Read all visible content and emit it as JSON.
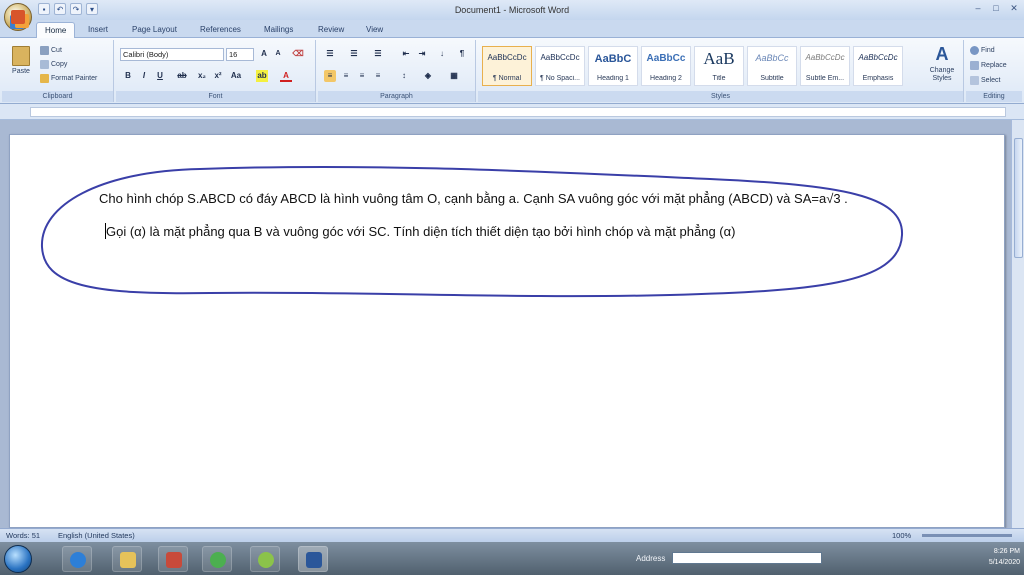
{
  "window": {
    "title": "Document1 - Microsoft Word"
  },
  "tabs": [
    {
      "label": "Home",
      "active": true
    },
    {
      "label": "Insert"
    },
    {
      "label": "Page Layout"
    },
    {
      "label": "References"
    },
    {
      "label": "Mailings"
    },
    {
      "label": "Review"
    },
    {
      "label": "View"
    }
  ],
  "clipboard": {
    "paste": "Paste",
    "cut": "Cut",
    "copy": "Copy",
    "format_painter": "Format Painter",
    "group": "Clipboard"
  },
  "font": {
    "name": "Calibri (Body)",
    "size": "16",
    "group": "Font"
  },
  "paragraph": {
    "group": "Paragraph"
  },
  "styles": {
    "items": [
      {
        "preview": "AaBbCcDc",
        "name": "¶ Normal"
      },
      {
        "preview": "AaBbCcDc",
        "name": "¶ No Spaci..."
      },
      {
        "preview": "AaBbC",
        "name": "Heading 1"
      },
      {
        "preview": "AaBbCc",
        "name": "Heading 2"
      },
      {
        "preview": "AaB",
        "name": "Title"
      },
      {
        "preview": "AaBbCc",
        "name": "Subtitle"
      },
      {
        "preview": "AaBbCcDc",
        "name": "Subtle Em..."
      },
      {
        "preview": "AaBbCcDc",
        "name": "Emphasis"
      }
    ],
    "change_styles": "Change Styles",
    "group": "Styles"
  },
  "editing": {
    "find": "Find",
    "replace": "Replace",
    "select": "Select",
    "group": "Editing"
  },
  "document": {
    "line1": "Cho hình chóp S.ABCD có đáy ABCD là hình vuông tâm O, cạnh bằng a. Cạnh SA vuông góc với mặt phẳng (ABCD) và SA=a√3 .",
    "line2": "Gọi (α) là mặt phẳng qua B và vuông góc với SC. Tính diện tích thiết diện tạo bởi hình chóp và mặt phẳng (α)"
  },
  "status": {
    "words": "Words: 51",
    "language": "English (United States)",
    "zoom": "100%"
  },
  "taskbar": {
    "address_label": "Address",
    "time": "8:26 PM",
    "date": "5/14/2020"
  },
  "colors": {
    "annotation": "#3a3fa8",
    "ribbon_bg": "#dde8f6"
  }
}
